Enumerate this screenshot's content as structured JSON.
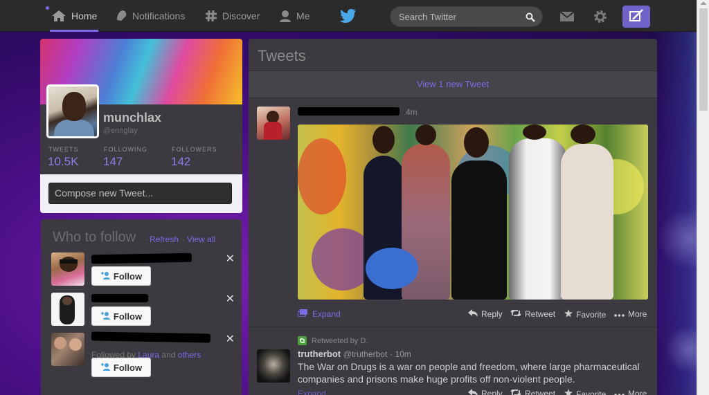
{
  "nav": {
    "home": "Home",
    "notifications": "Notifications",
    "discover": "Discover",
    "me": "Me"
  },
  "search": {
    "placeholder": "Search Twitter"
  },
  "profile": {
    "name": "munchlax",
    "handle": "@ennglay",
    "stats": [
      {
        "label": "TWEETS",
        "value": "10.5K"
      },
      {
        "label": "FOLLOWING",
        "value": "147"
      },
      {
        "label": "FOLLOWERS",
        "value": "142"
      }
    ],
    "compose_placeholder": "Compose new Tweet..."
  },
  "who_to_follow": {
    "title": "Who to follow",
    "separator": "·",
    "refresh": "Refresh",
    "view_all": "View all",
    "follow_label": "Follow",
    "dismiss": "✕",
    "third_followed_by": {
      "prefix": "Followed by",
      "person": "Laura",
      "and": "and",
      "others": "others"
    }
  },
  "tweets": {
    "title": "Tweets",
    "new_tweets": "View 1 new Tweet",
    "first": {
      "time": "4m",
      "actions": {
        "expand": "Expand",
        "reply": "Reply",
        "retweet": "Retweet",
        "favorite": "Favorite",
        "more": "More"
      }
    },
    "second": {
      "retweeted_by": "Retweeted by D.",
      "name": "trutherbot",
      "handle": "@trutherbot",
      "separator": "·",
      "time": "10m",
      "text": "The War on Drugs is a war on people and freedom, where large pharmaceutical companies and prisons make huge profits off non-violent people."
    }
  },
  "colors": {
    "accent": "#7b6ce6",
    "topbar": "#2b2b2b",
    "panel": "#3c3a40"
  }
}
